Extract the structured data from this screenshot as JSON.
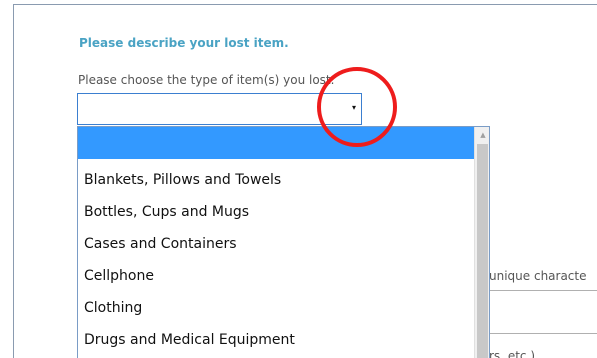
{
  "form": {
    "heading": "Please describe your lost item.",
    "type_prompt": "Please choose the type of item(s) you lost.",
    "selected_value": "",
    "dropdown_arrow": "▾"
  },
  "dropdown": {
    "options": [
      "",
      "Blankets, Pillows and Towels",
      "Bottles, Cups and Mugs",
      "Cases and Containers",
      "Cellphone",
      "Clothing",
      "Drugs and Medical Equipment"
    ],
    "highlighted_index": 0,
    "scroll_up_arrow": "▲"
  },
  "partial_text": {
    "characteristics": "unique characte",
    "examples": "rs, etc.)"
  },
  "colors": {
    "heading": "#4aa3c4",
    "highlight": "#3399ff",
    "annotation": "#ee1c1c"
  }
}
